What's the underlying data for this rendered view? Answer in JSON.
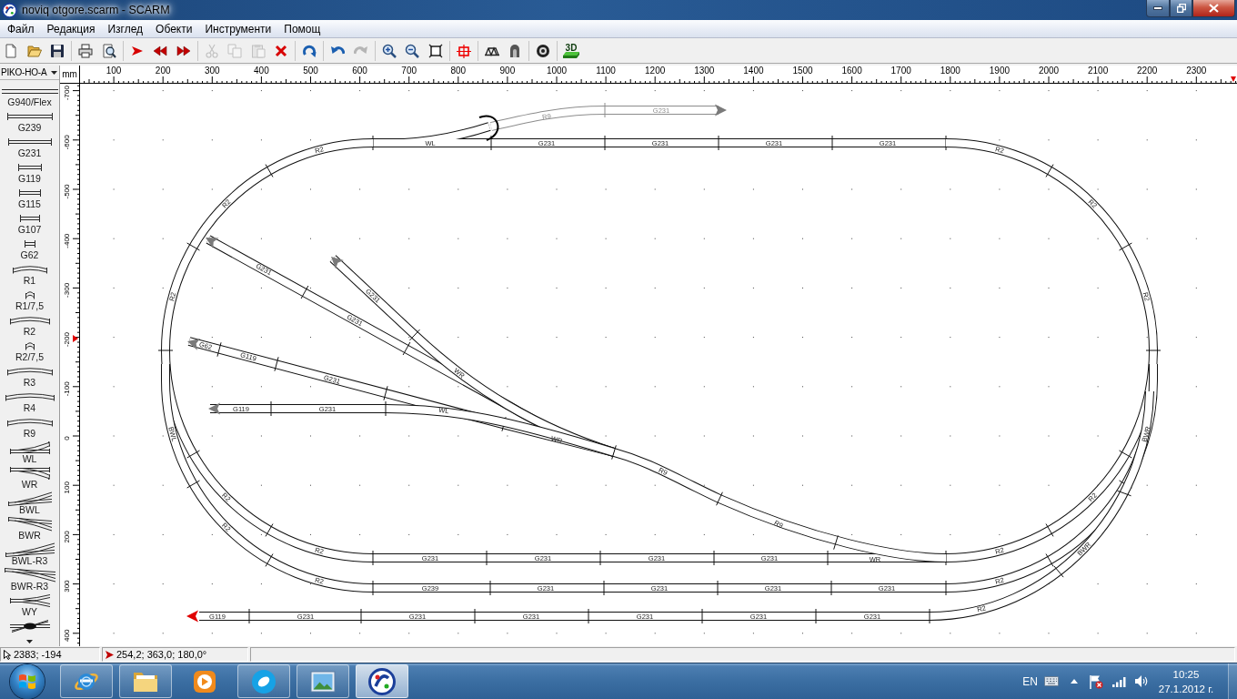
{
  "window": {
    "title": "noviq otgore.scarm - SCARM"
  },
  "menu": [
    "Файл",
    "Редакция",
    "Изглед",
    "Обекти",
    "Инструменти",
    "Помощ"
  ],
  "toolbar": [
    [
      {
        "disabled": false
      },
      {
        "disabled": false
      },
      {
        "disabled": false
      }
    ],
    [
      {
        "disabled": false
      },
      {
        "disabled": false
      }
    ],
    [
      {
        "disabled": false
      },
      {
        "disabled": false
      },
      {
        "disabled": false
      }
    ],
    [
      {
        "disabled": true
      },
      {
        "disabled": true
      },
      {
        "disabled": true
      },
      {
        "disabled": false
      }
    ],
    [
      {
        "disabled": false
      }
    ],
    [
      {
        "disabled": false
      },
      {
        "disabled": true
      }
    ],
    [
      {
        "disabled": false
      },
      {
        "disabled": false
      },
      {
        "disabled": false
      }
    ],
    [
      {
        "disabled": false
      }
    ],
    [
      {
        "disabled": false
      },
      {
        "disabled": false
      }
    ],
    [
      {
        "disabled": false
      }
    ],
    [
      {
        "disabled": false,
        "label": "3D"
      }
    ]
  ],
  "library": {
    "selector": "PIKO-HO-A",
    "items": [
      {
        "kind": "flex",
        "label": "G940/Flex"
      },
      {
        "kind": "straight",
        "label": "G239"
      },
      {
        "kind": "straight",
        "label": "G231"
      },
      {
        "kind": "straight",
        "label": "G119"
      },
      {
        "kind": "straight",
        "label": "G115"
      },
      {
        "kind": "straight",
        "label": "G107"
      },
      {
        "kind": "straight",
        "label": "G62"
      },
      {
        "kind": "curve",
        "label": "R1"
      },
      {
        "kind": "curve",
        "label": "R1/7,5"
      },
      {
        "kind": "curve",
        "label": "R2"
      },
      {
        "kind": "curve",
        "label": "R2/7,5"
      },
      {
        "kind": "curve",
        "label": "R3"
      },
      {
        "kind": "curve",
        "label": "R4"
      },
      {
        "kind": "curve",
        "label": "R9"
      },
      {
        "kind": "turnout",
        "label": "WL"
      },
      {
        "kind": "turnout",
        "label": "WR"
      },
      {
        "kind": "curved_turnout",
        "label": "BWL"
      },
      {
        "kind": "curved_turnout",
        "label": "BWR"
      },
      {
        "kind": "curved_turnout",
        "label": "BWL-R3"
      },
      {
        "kind": "curved_turnout",
        "label": "BWR-R3"
      },
      {
        "kind": "wye_turnout",
        "label": "WY"
      },
      {
        "kind": "crossing"
      }
    ]
  },
  "ruler": {
    "unit": "mm",
    "horizontal": [
      "100",
      "200",
      "300",
      "400",
      "500",
      "600",
      "700",
      "800",
      "900",
      "1000",
      "1100",
      "1200",
      "1300",
      "1400",
      "1500",
      "1600",
      "1700",
      "1800",
      "1900",
      "2000",
      "2100",
      "2200",
      "2300"
    ],
    "vertical": [
      "-700",
      "-600",
      "-500",
      "-400",
      "-300",
      "-200",
      "-100",
      "0",
      "100",
      "200",
      "300",
      "400"
    ]
  },
  "canvas": {
    "tracks": [
      {
        "dimmed": true,
        "labels": [
          "R9",
          "G231"
        ]
      },
      {
        "dimmed": false,
        "labels": [
          "WL",
          "G231",
          "G231",
          "G231",
          "G231"
        ]
      },
      {
        "dimmed": false,
        "labels": [
          "R2",
          "R2",
          "R2",
          "R2",
          "R2",
          "G231",
          "G231",
          "G231",
          "G231",
          "WR",
          "R2",
          "R2",
          "R2",
          "R2",
          "R2"
        ]
      },
      {
        "dimmed": false,
        "labels": [
          "G231",
          "G231"
        ]
      },
      {
        "dimmed": false,
        "labels": [
          "G231",
          "WR"
        ]
      },
      {
        "dimmed": false,
        "labels": [
          "G62",
          "G119",
          "G231"
        ]
      },
      {
        "dimmed": false,
        "labels": [
          "G119",
          "G231",
          "WL"
        ]
      },
      {
        "dimmed": false,
        "labels": [
          "WR",
          "R9",
          "R9"
        ]
      },
      {
        "dimmed": false,
        "labels": [
          "BWL",
          "R2",
          "R2",
          "G239",
          "G231",
          "G231",
          "G231",
          "G231",
          "R2",
          "BWR"
        ]
      },
      {
        "dimmed": false,
        "labels": [
          "G119",
          "G231",
          "G231",
          "G231",
          "G231",
          "G231",
          "G231",
          "R2",
          "BWR"
        ]
      }
    ],
    "end_markers": [
      {
        "selected": false
      },
      {
        "selected": false
      },
      {
        "selected": false
      },
      {
        "selected": false
      },
      {
        "selected": false
      },
      {
        "selected": true
      }
    ]
  },
  "status_bar": {
    "cursor": "2383; -194",
    "selection": "254,2; 363,0; 180,0°"
  },
  "taskbar": {
    "apps": [
      {
        "running": true,
        "selected": false
      },
      {
        "running": true,
        "selected": false
      },
      {
        "running": false,
        "selected": false
      },
      {
        "running": true,
        "selected": false
      },
      {
        "running": true,
        "selected": false
      },
      {
        "running": true,
        "selected": true
      }
    ],
    "language": "EN",
    "time": "10:25",
    "date": "27.1.2012 г."
  }
}
